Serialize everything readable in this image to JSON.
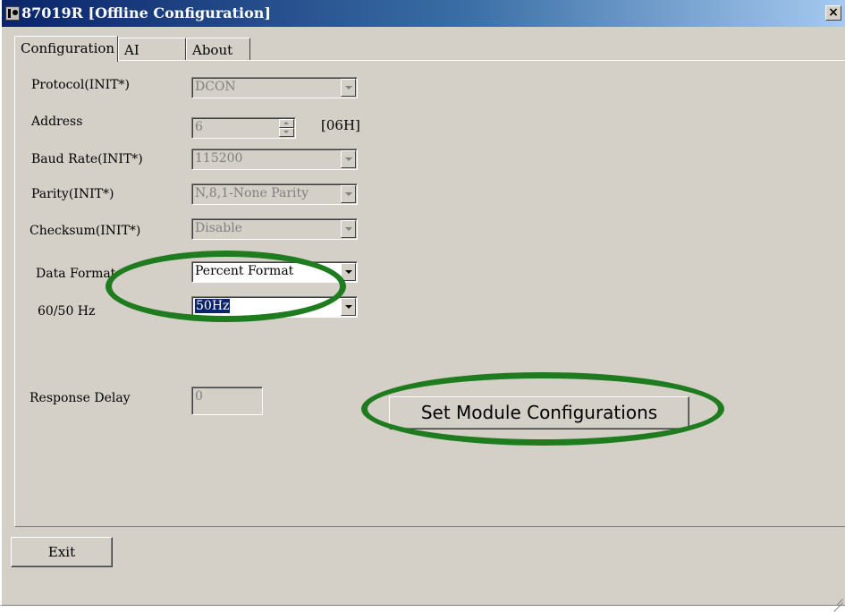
{
  "window": {
    "title": "87019R  [Offline Configuration]",
    "close_label": "×"
  },
  "tabs": [
    {
      "label": "Configuration"
    },
    {
      "label": "AI"
    },
    {
      "label": "About"
    }
  ],
  "form": {
    "protocol": {
      "label": "Protocol(INIT*)",
      "value": "DCON"
    },
    "address": {
      "label": "Address",
      "value": "6",
      "hex": "[06H]"
    },
    "baud_rate": {
      "label": "Baud Rate(INIT*)",
      "value": "115200"
    },
    "parity": {
      "label": "Parity(INIT*)",
      "value": "N,8,1-None Parity"
    },
    "checksum": {
      "label": "Checksum(INIT*)",
      "value": "Disable"
    },
    "data_format": {
      "label": "Data Format",
      "value": "Percent Format"
    },
    "frequency": {
      "label": "60/50 Hz",
      "value": "50Hz"
    },
    "response_delay": {
      "label": "Response Delay",
      "value": "0"
    }
  },
  "buttons": {
    "set_module": "Set Module Configurations",
    "exit": "Exit"
  },
  "colors": {
    "highlight_oval": "#1e7b1e",
    "titlebar_start": "#0a246a",
    "titlebar_end": "#a6caf0",
    "face": "#d4d0c8"
  }
}
